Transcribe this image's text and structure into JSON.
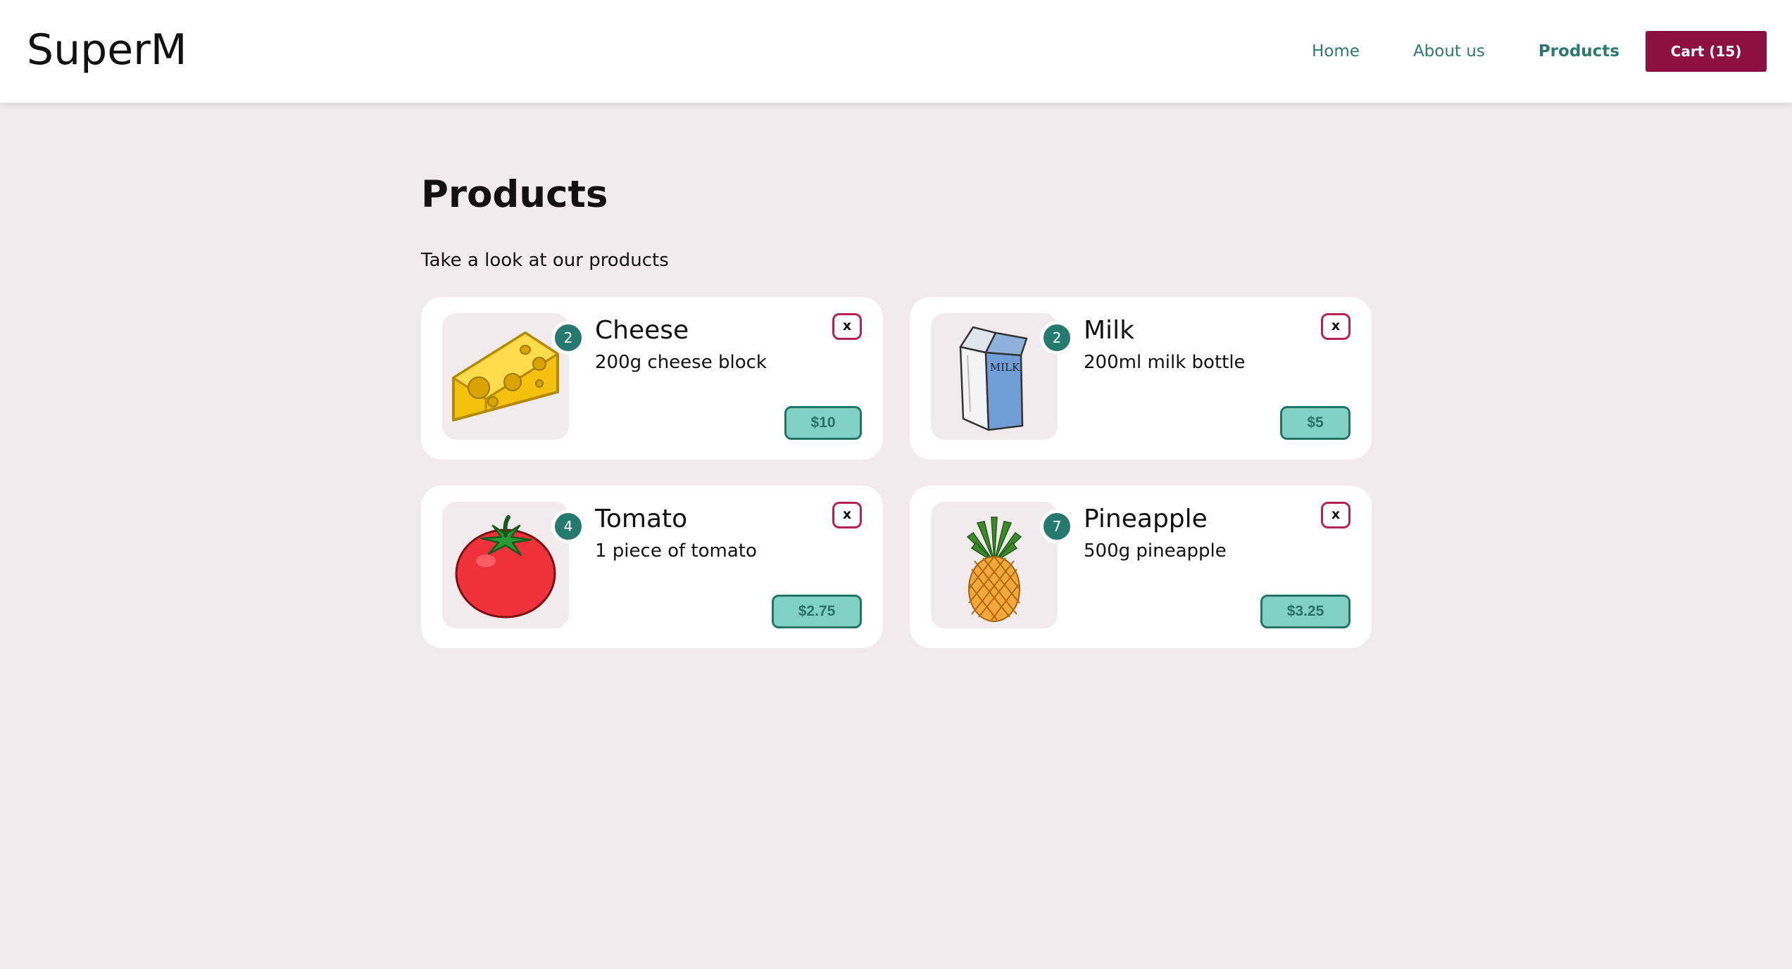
{
  "header": {
    "logo": "SuperM",
    "nav": [
      {
        "label": "Home"
      },
      {
        "label": "About us"
      },
      {
        "label": "Products"
      }
    ],
    "cart_label": "Cart (15)"
  },
  "main": {
    "title": "Products",
    "subtitle": "Take a look at our products"
  },
  "products": [
    {
      "name": "Cheese",
      "description": "200g cheese block",
      "quantity": "2",
      "price": "$10",
      "remove_label": "x",
      "icon": "cheese-icon"
    },
    {
      "name": "Milk",
      "description": "200ml milk bottle",
      "quantity": "2",
      "price": "$5",
      "remove_label": "x",
      "icon": "milk-carton-icon",
      "image_text": "MILK"
    },
    {
      "name": "Tomato",
      "description": "1 piece of tomato",
      "quantity": "4",
      "price": "$2.75",
      "remove_label": "x",
      "icon": "tomato-icon"
    },
    {
      "name": "Pineapple",
      "description": "500g pineapple",
      "quantity": "7",
      "price": "$3.25",
      "remove_label": "x",
      "icon": "pineapple-icon"
    }
  ],
  "colors": {
    "accent": "#2b7a70",
    "cart": "#8c1040",
    "remove_border": "#b52450",
    "price_bg": "#82d1c5",
    "page_bg": "#f1ebee"
  }
}
